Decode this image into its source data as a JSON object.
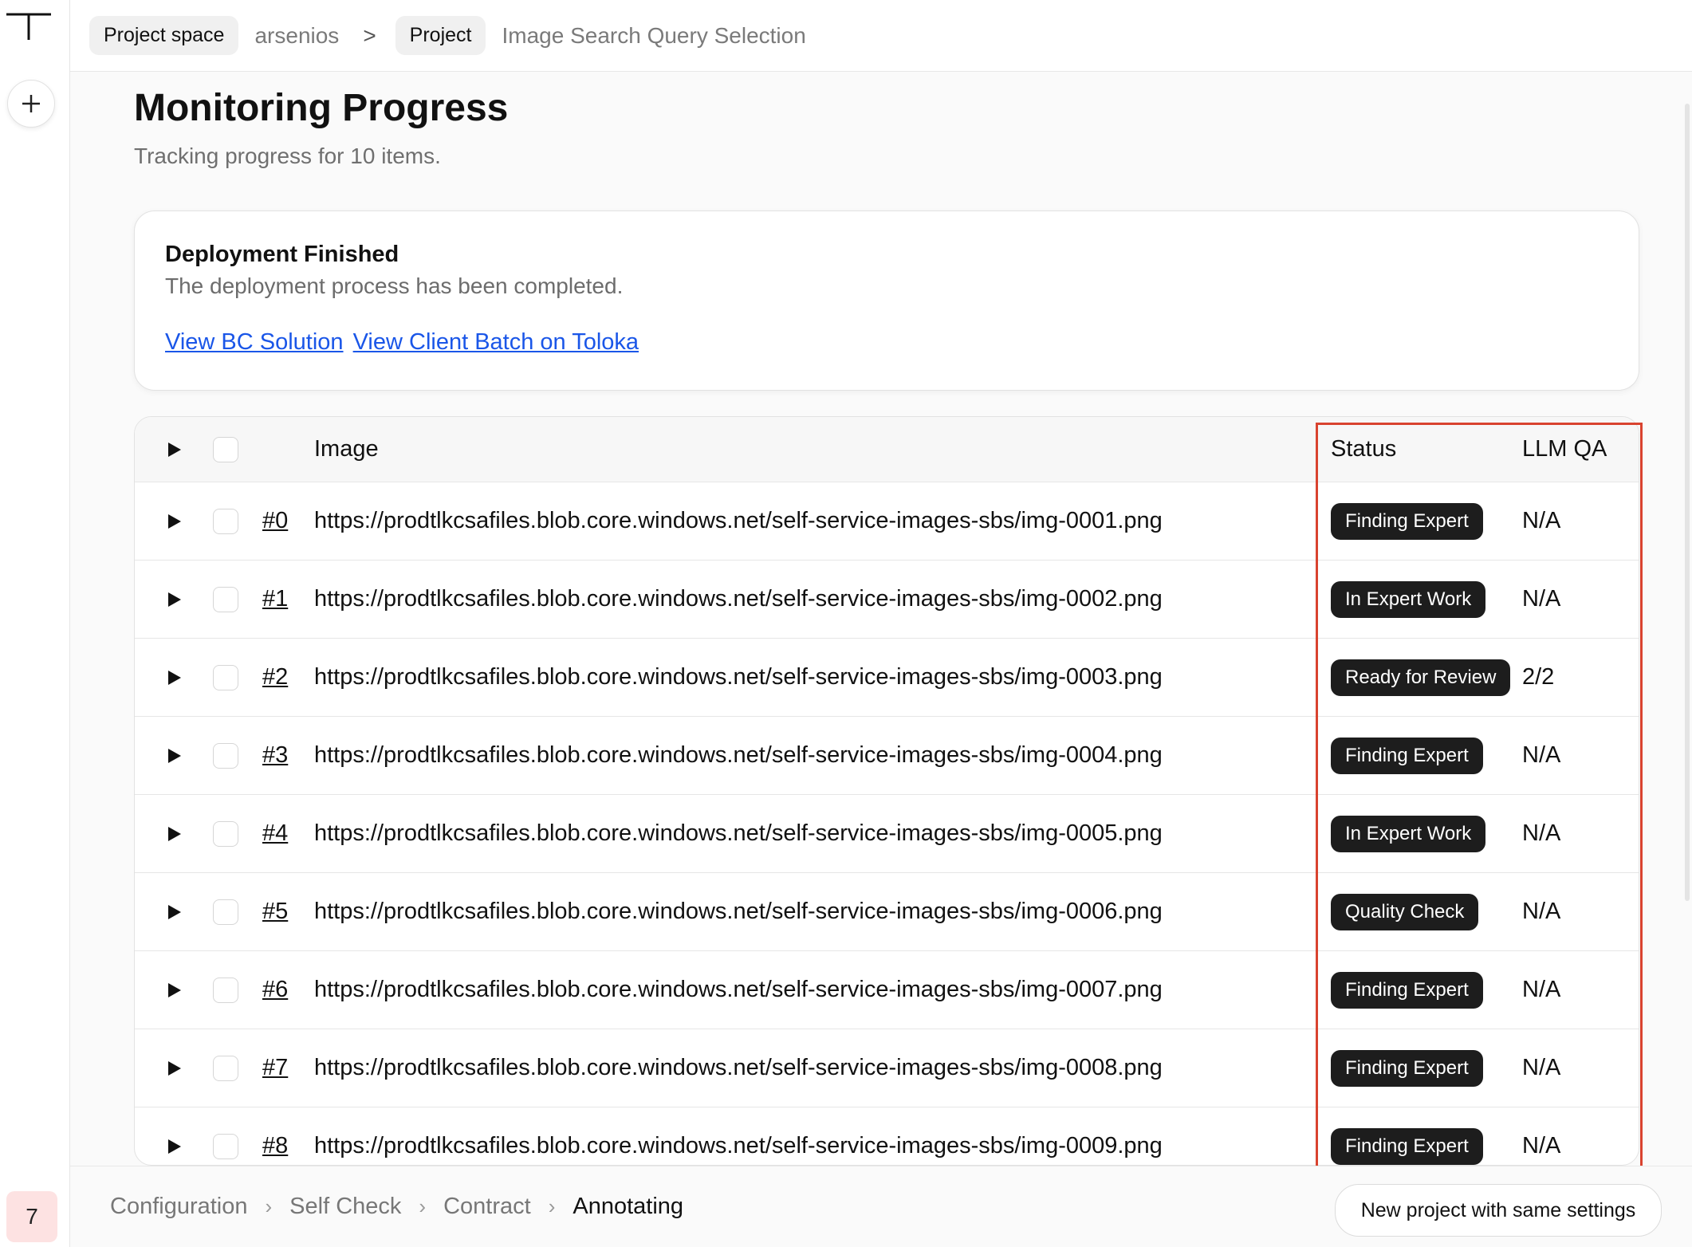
{
  "breadcrumb": {
    "space_chip": "Project space",
    "space_name": "arsenios",
    "separator": ">",
    "project_chip": "Project",
    "project_name": "Image Search Query Selection"
  },
  "page": {
    "title": "Monitoring Progress",
    "subtitle": "Tracking progress for 10 items."
  },
  "deployment": {
    "title": "Deployment Finished",
    "description": "The deployment process has been completed.",
    "link_bc": "View BC Solution",
    "link_batch": "View Client Batch on Toloka"
  },
  "table": {
    "headers": {
      "image": "Image",
      "status": "Status",
      "llm_qa": "LLM QA"
    },
    "rows": [
      {
        "index": "#0",
        "url": "https://prodtlkcsafiles.blob.core.windows.net/self-service-images-sbs/img-0001.png",
        "status": "Finding Expert",
        "llm_qa": "N/A"
      },
      {
        "index": "#1",
        "url": "https://prodtlkcsafiles.blob.core.windows.net/self-service-images-sbs/img-0002.png",
        "status": "In Expert Work",
        "llm_qa": "N/A"
      },
      {
        "index": "#2",
        "url": "https://prodtlkcsafiles.blob.core.windows.net/self-service-images-sbs/img-0003.png",
        "status": "Ready for Review",
        "llm_qa": "2/2"
      },
      {
        "index": "#3",
        "url": "https://prodtlkcsafiles.blob.core.windows.net/self-service-images-sbs/img-0004.png",
        "status": "Finding Expert",
        "llm_qa": "N/A"
      },
      {
        "index": "#4",
        "url": "https://prodtlkcsafiles.blob.core.windows.net/self-service-images-sbs/img-0005.png",
        "status": "In Expert Work",
        "llm_qa": "N/A"
      },
      {
        "index": "#5",
        "url": "https://prodtlkcsafiles.blob.core.windows.net/self-service-images-sbs/img-0006.png",
        "status": "Quality Check",
        "llm_qa": "N/A"
      },
      {
        "index": "#6",
        "url": "https://prodtlkcsafiles.blob.core.windows.net/self-service-images-sbs/img-0007.png",
        "status": "Finding Expert",
        "llm_qa": "N/A"
      },
      {
        "index": "#7",
        "url": "https://prodtlkcsafiles.blob.core.windows.net/self-service-images-sbs/img-0008.png",
        "status": "Finding Expert",
        "llm_qa": "N/A"
      },
      {
        "index": "#8",
        "url": "https://prodtlkcsafiles.blob.core.windows.net/self-service-images-sbs/img-0009.png",
        "status": "Finding Expert",
        "llm_qa": "N/A"
      }
    ]
  },
  "steps": {
    "configuration": "Configuration",
    "self_check": "Self Check",
    "contract": "Contract",
    "annotating": "Annotating",
    "separator": "›"
  },
  "footer": {
    "new_project_label": "New project with same settings"
  },
  "sidebar": {
    "notification_count": "7"
  },
  "colors": {
    "link": "#1a56e8",
    "badge_bg": "#1d1d1d",
    "highlight_border": "#d9432f",
    "notification_bg": "#fde2e2"
  }
}
